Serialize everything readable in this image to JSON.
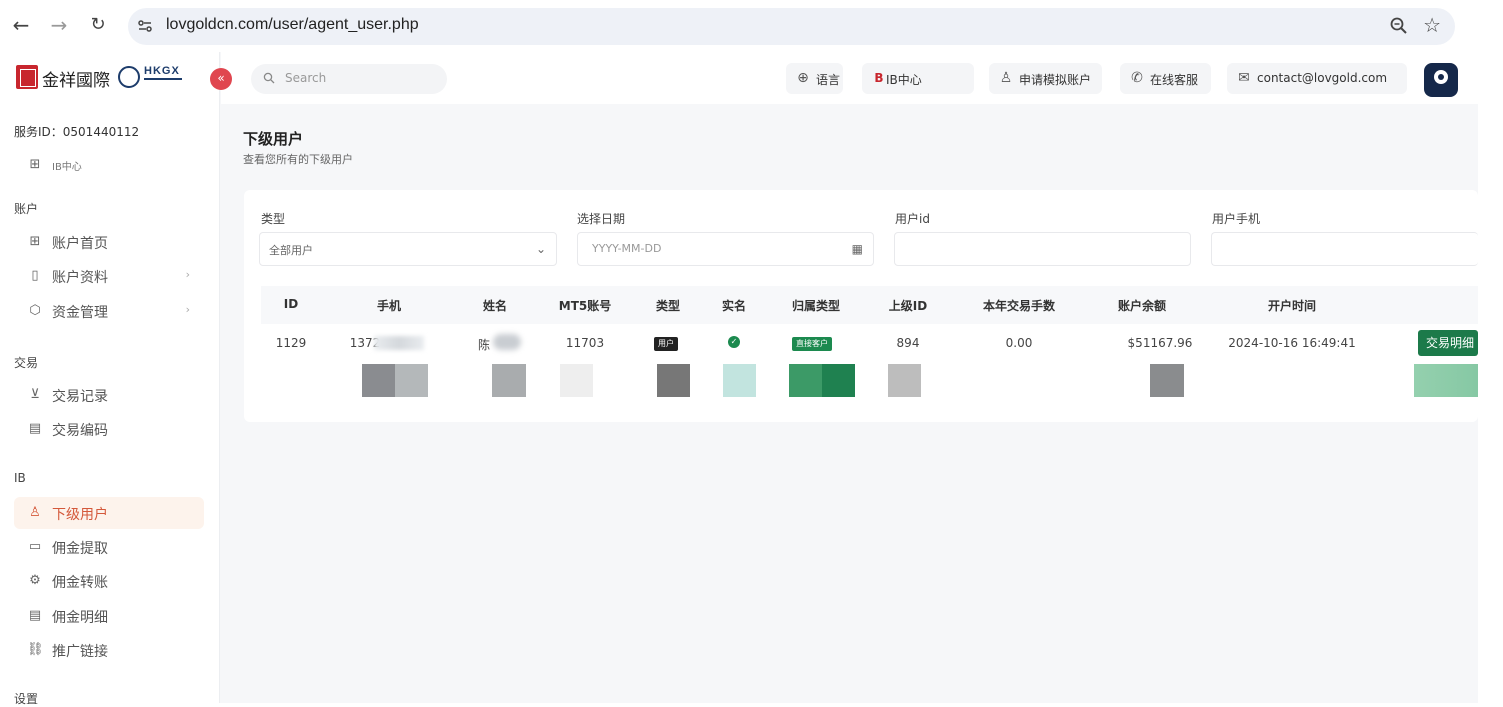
{
  "browser": {
    "back_icon": "back-arrow-icon",
    "forward_icon": "forward-arrow-icon",
    "reload_icon": "reload-icon",
    "url": "lovgoldcn.com/user/agent_user.php"
  },
  "brand": {
    "name_cn": "金祥國際",
    "partner": "HKGX"
  },
  "topbar": {
    "search_placeholder": "Search",
    "language_label": "语言",
    "ib_label": "IB中心",
    "ib_prefix": "B",
    "demo_label": "申请模拟账户",
    "support_label": "在线客服",
    "email_label": "contact@lovgold.com"
  },
  "sidebar": {
    "service_id": "服务ID：0501440112",
    "ib_center": "IB中心",
    "sections": {
      "account": "账户",
      "trade": "交易",
      "ib": "IB",
      "settings": "设置"
    },
    "items": [
      {
        "label": "账户首页"
      },
      {
        "label": "账户资料"
      },
      {
        "label": "资金管理"
      },
      {
        "label": "交易记录"
      },
      {
        "label": "交易编码"
      },
      {
        "label": "下级用户"
      },
      {
        "label": "佣金提取"
      },
      {
        "label": "佣金转账"
      },
      {
        "label": "佣金明细"
      },
      {
        "label": "推广链接"
      }
    ]
  },
  "page": {
    "title": "下级用户",
    "subtitle": "查看您所有的下级用户"
  },
  "filters": {
    "type_label": "类型",
    "type_value": "全部用户",
    "date_label": "选择日期",
    "date_placeholder": "YYYY-MM-DD",
    "userid_label": "用户id",
    "phone_label": "用户手机"
  },
  "table": {
    "headers": [
      "ID",
      "手机",
      "姓名",
      "MT5账号",
      "类型",
      "实名",
      "归属类型",
      "上级ID",
      "本年交易手数",
      "账户余额",
      "开户时间"
    ],
    "rows": [
      {
        "id": "1129",
        "phone": "1372",
        "name": "陈",
        "mt5": "11703",
        "type": "用户",
        "verified": "check-icon",
        "owner_type": "直接客户",
        "parent_id": "894",
        "lots": "0.00",
        "balance": "$51167.96",
        "opened": "2024-10-16 16:49:41",
        "action": "交易明细"
      }
    ]
  },
  "colors": {
    "accent": "#d4583a",
    "green": "#1c7a4a",
    "navy": "#15284a",
    "collapse": "#e0464f"
  }
}
